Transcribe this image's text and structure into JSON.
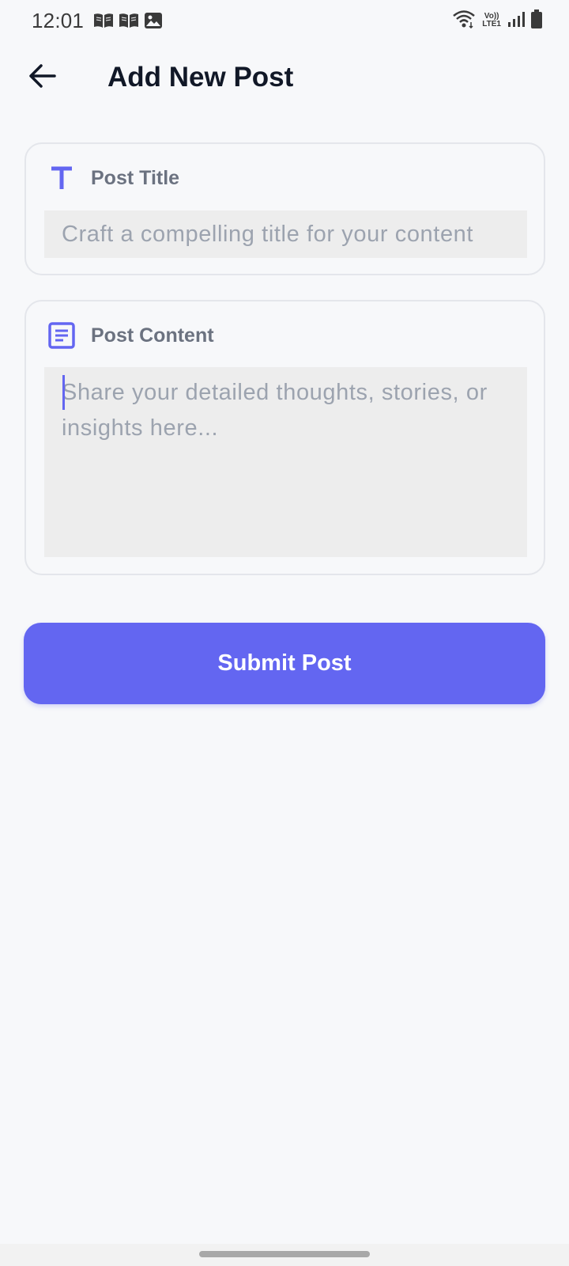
{
  "status_bar": {
    "time": "12:01",
    "notification_icons": [
      "book-icon",
      "book-icon",
      "image-icon"
    ],
    "lte_top": "Vo))",
    "lte_bottom": "LTE1",
    "system_icons": [
      "wifi-icon",
      "volte-icon",
      "signal-icon",
      "battery-icon"
    ]
  },
  "app_bar": {
    "back_icon": "arrow-left-icon",
    "title": "Add New Post"
  },
  "form": {
    "title_field": {
      "icon": "text-t-icon",
      "label": "Post Title",
      "value": "",
      "placeholder": "Craft a compelling title for your content"
    },
    "content_field": {
      "icon": "article-icon",
      "label": "Post Content",
      "value": "",
      "placeholder": "Share your detailed thoughts, stories, or insights here..."
    },
    "submit_label": "Submit Post"
  },
  "colors": {
    "accent": "#6366f1",
    "background": "#f7f8fa",
    "input_fill": "#ededed",
    "label_gray": "#6b7280",
    "placeholder_gray": "#9ca3af",
    "title_text": "#111827"
  }
}
